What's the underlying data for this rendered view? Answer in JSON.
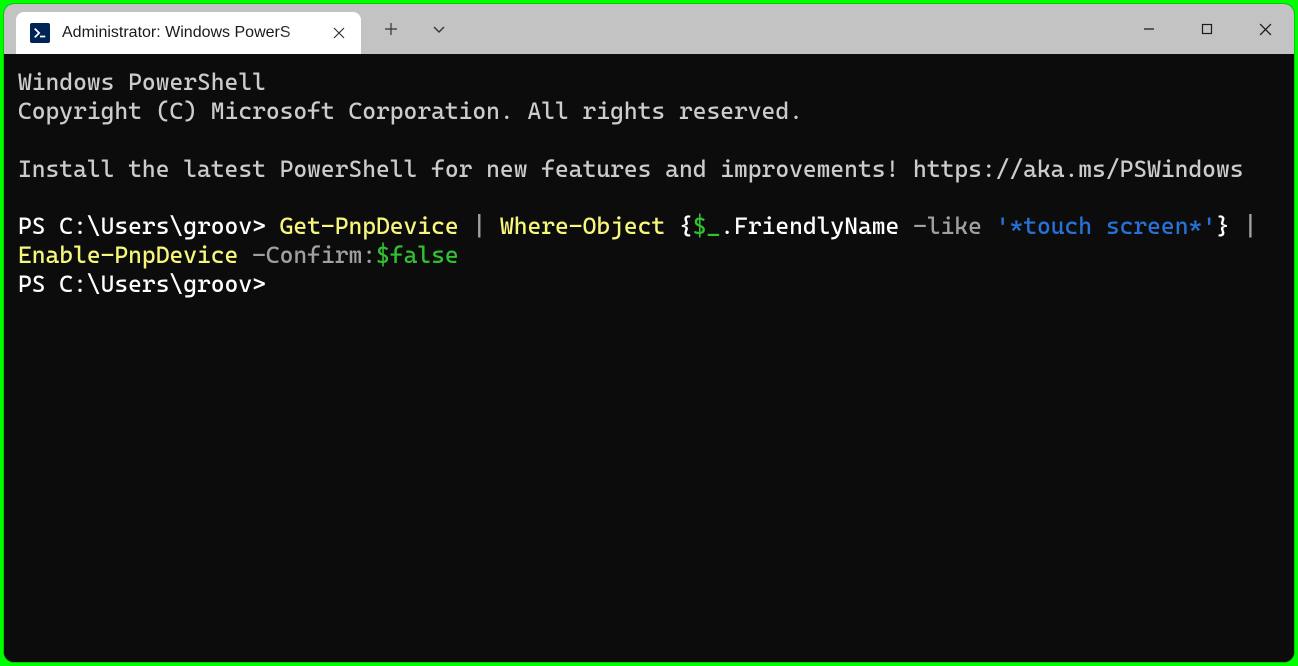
{
  "tab": {
    "title": "Administrator: Windows PowerS"
  },
  "terminal": {
    "banner_line1": "Windows PowerShell",
    "banner_line2": "Copyright (C) Microsoft Corporation. All rights reserved.",
    "banner_line3": "Install the latest PowerShell for new features and improvements! https://aka.ms/PSWindows",
    "prompt1_prefix": "PS C:\\Users\\groov> ",
    "cmd1": {
      "cmdlet1": "Get-PnpDevice",
      "pipe1": " | ",
      "cmdlet2": "Where-Object",
      "brace_open": " {",
      "var": "$_",
      "member": ".FriendlyName ",
      "op_like": "-like ",
      "string": "'*touch screen*'",
      "brace_close": "}",
      "pipe2": " | ",
      "cmdlet3": "Enable-PnpDevice",
      "space": " ",
      "param": "-Confirm:",
      "false": "$false"
    },
    "prompt2_prefix": "PS C:\\Users\\groov>"
  }
}
